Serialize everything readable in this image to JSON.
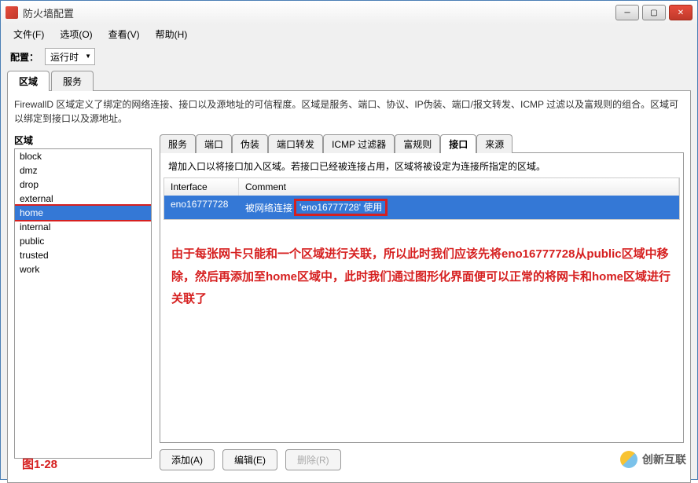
{
  "title": "防火墙配置",
  "menu": {
    "file": "文件(F)",
    "options": "选项(O)",
    "view": "查看(V)",
    "help": "帮助(H)"
  },
  "config": {
    "label": "配置：",
    "value": "运行时"
  },
  "topTabs": {
    "zone": "区域",
    "service": "服务"
  },
  "desc": "FirewallD 区域定义了绑定的网络连接、接口以及源地址的可信程度。区域是服务、端口、协议、IP伪装、端口/报文转发、ICMP 过滤以及富规则的组合。区域可以绑定到接口以及源地址。",
  "zoneLabel": "区域",
  "zones": [
    "block",
    "dmz",
    "drop",
    "external",
    "home",
    "internal",
    "public",
    "trusted",
    "work"
  ],
  "selectedZone": "home",
  "subTabs": {
    "service": "服务",
    "port": "端口",
    "masq": "伪装",
    "fwd": "端口转发",
    "icmp": "ICMP 过滤器",
    "rich": "富规则",
    "iface": "接口",
    "src": "来源"
  },
  "ifaceDesc": "增加入口以将接口加入区域。若接口已经被连接占用，区域将被设定为连接所指定的区域。",
  "ifaceHeader": {
    "if": "Interface",
    "com": "Comment"
  },
  "ifaceRow": {
    "if": "eno16777728",
    "com1": "被网络连接",
    "com2": "'eno16777728' 使用"
  },
  "annotation": "由于每张网卡只能和一个区域进行关联，所以此时我们应该先将eno16777728从public区域中移除，然后再添加至home区域中，此时我们通过图形化界面便可以正常的将网卡和home区域进行关联了",
  "btns": {
    "add": "添加(A)",
    "edit": "编辑(E)",
    "del": "删除(R)"
  },
  "figLabel": "图1-28",
  "watermark": "创新互联"
}
